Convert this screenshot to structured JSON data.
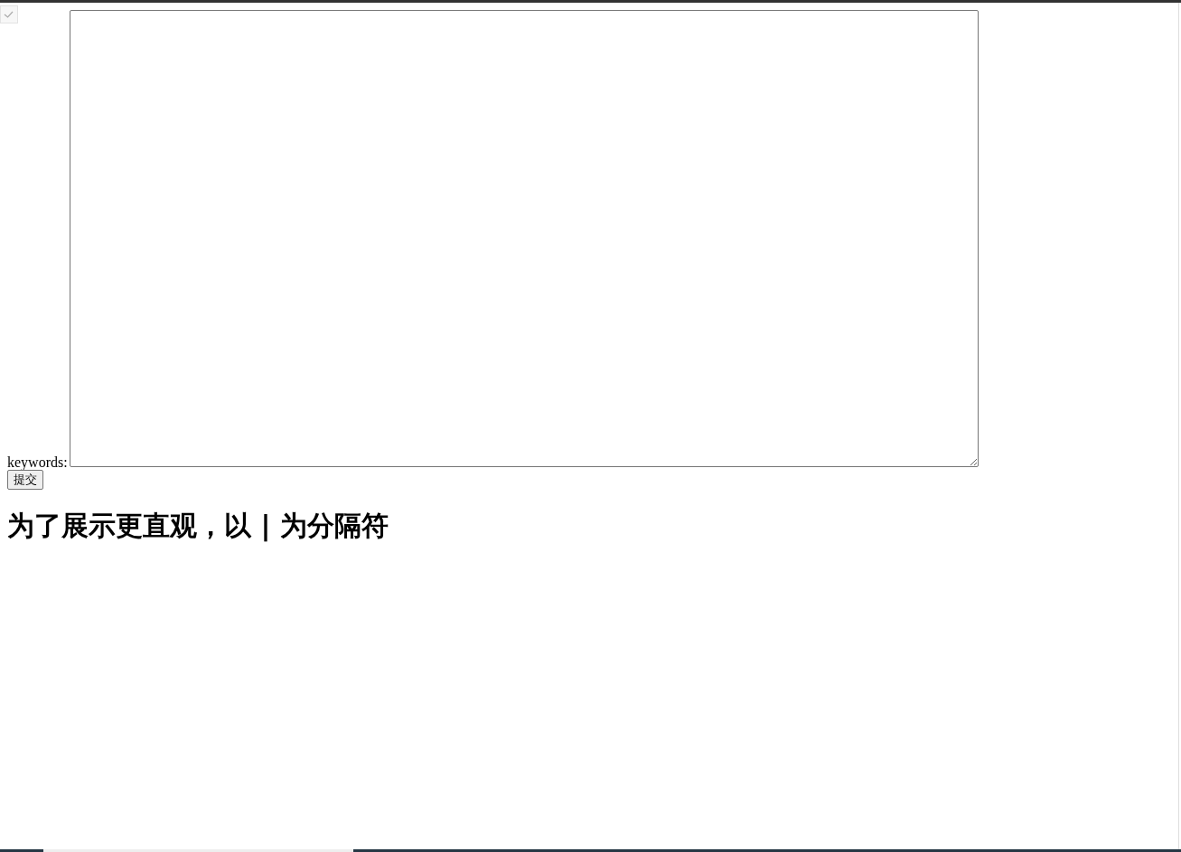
{
  "form": {
    "label": "keywords:",
    "submit": "提交"
  },
  "heading": "为了展示更直观，以 | 为分隔符"
}
